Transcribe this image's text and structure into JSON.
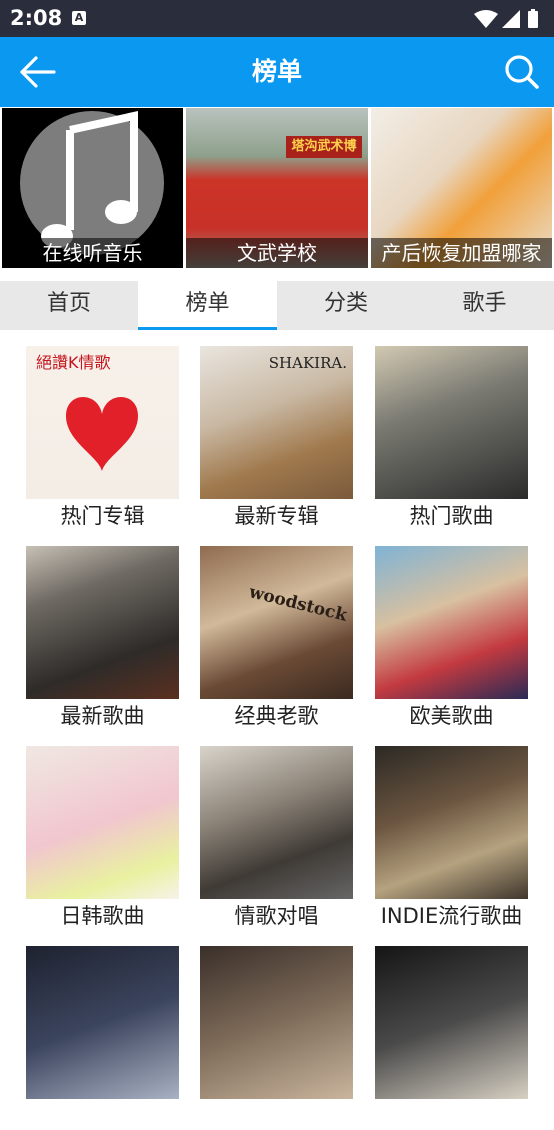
{
  "status_bar": {
    "time": "2:08",
    "notification_icon": "A"
  },
  "app_bar": {
    "title": "榜单",
    "back_icon": "arrow-left-icon",
    "search_icon": "search-icon"
  },
  "banner": {
    "items": [
      {
        "caption": "在线听音乐"
      },
      {
        "caption": "文武学校",
        "sign_text": "塔沟武术博"
      },
      {
        "caption": "产后恢复加盟哪家"
      }
    ]
  },
  "tabs": [
    {
      "label": "首页",
      "active": false
    },
    {
      "label": "榜单",
      "active": true
    },
    {
      "label": "分类",
      "active": false
    },
    {
      "label": "歌手",
      "active": false
    }
  ],
  "grid": [
    {
      "label": "热门专辑",
      "art_text": "絕讚K情歌"
    },
    {
      "label": "最新专辑",
      "art_text": "SHAKIRA."
    },
    {
      "label": "热门歌曲"
    },
    {
      "label": "最新歌曲"
    },
    {
      "label": "经典老歌",
      "art_text": "woodstock"
    },
    {
      "label": "欧美歌曲"
    },
    {
      "label": "日韩歌曲"
    },
    {
      "label": "情歌对唱"
    },
    {
      "label": "INDIE流行歌曲"
    },
    {
      "label": ""
    },
    {
      "label": ""
    },
    {
      "label": ""
    }
  ],
  "colors": {
    "accent": "#0a98f0",
    "status_bar": "#2a2d3b",
    "tab_bg": "#e8e8e8"
  }
}
